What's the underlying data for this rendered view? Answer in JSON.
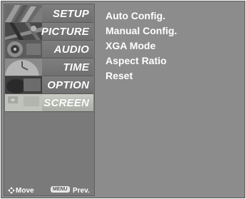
{
  "menu": {
    "items": [
      {
        "label": "SETUP",
        "icon": "setup-icon"
      },
      {
        "label": "PICTURE",
        "icon": "picture-icon"
      },
      {
        "label": "AUDIO",
        "icon": "audio-icon"
      },
      {
        "label": "TIME",
        "icon": "time-icon"
      },
      {
        "label": "OPTION",
        "icon": "option-icon"
      },
      {
        "label": "SCREEN",
        "icon": "screen-icon"
      }
    ],
    "active": "SCREEN"
  },
  "submenu": {
    "options": [
      "Auto Config.",
      "Manual Config.",
      "XGA Mode",
      "Aspect Ratio",
      "Reset"
    ]
  },
  "footer": {
    "move_label": "Move",
    "menu_key": "MENU",
    "prev_label": "Prev."
  },
  "colors": {
    "panel_bg": "#8c8c8c",
    "active_item": "#b5b9b2",
    "text": "#ffffff"
  }
}
